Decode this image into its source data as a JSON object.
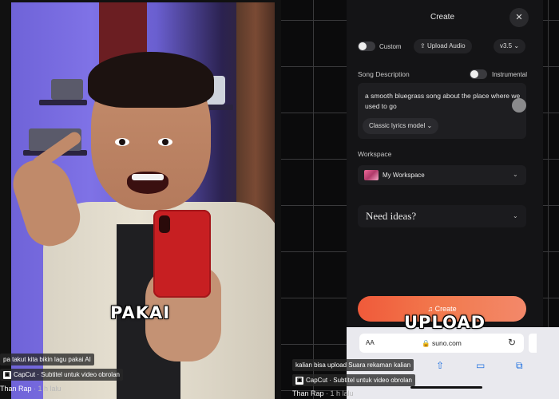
{
  "left_video": {
    "caption": "PAKAI",
    "overlay_text": "pa takut kita bikin lagu pakai AI",
    "capcut_logo": "▣",
    "capcut_line": "CapCut · Subtitel untuk video obrolan",
    "author": "Than Rap",
    "time": "· 1 h lalu"
  },
  "right_video": {
    "caption": "UPLOAD",
    "overlay_text": "kalian bisa upload Suara rekaman kalian",
    "capcut_logo": "▣",
    "capcut_line": "CapCut · Subtitel untuk video obrolan",
    "author": "Than Rap",
    "time": "· 1 h lalu"
  },
  "modal": {
    "title": "Create",
    "close_icon": "✕",
    "custom_label": "Custom",
    "upload_audio_label": "Upload Audio",
    "upload_icon": "⇪",
    "version": "v3.5",
    "chevron": "⌄",
    "song_description_label": "Song Description",
    "instrumental_label": "Instrumental",
    "description_text": "a smooth bluegrass song about the place where we used to go",
    "model_label": "Classic lyrics model",
    "workspace_label": "Workspace",
    "workspace_value": "My Workspace",
    "ideas_label": "Need ideas?",
    "create_label": "Create",
    "create_icon": "♫"
  },
  "browser": {
    "aa": "AA",
    "url": "🔒 suno.com",
    "reload_icon": "↻",
    "share_icon": "⇧",
    "book_icon": "▭",
    "tabs_icon": "⧉"
  },
  "colors": {
    "accent_create": "#f27a4e",
    "modal_bg": "#141416"
  }
}
